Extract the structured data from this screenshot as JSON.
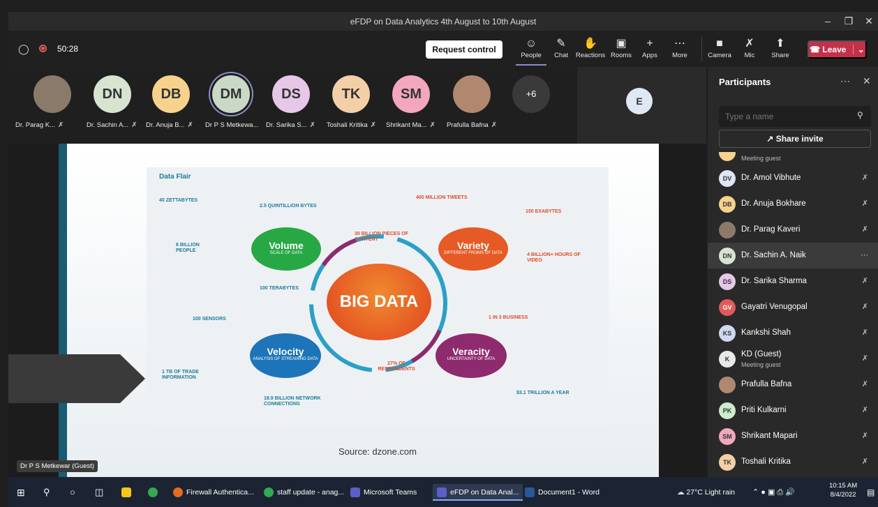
{
  "window": {
    "title": "eFDP on Data Analytics 4th August to 10th August"
  },
  "toolbar": {
    "timer": "50:28",
    "request_control": "Request control",
    "buttons": [
      {
        "label": "People",
        "icon": "people-icon"
      },
      {
        "label": "Chat",
        "icon": "chat-icon"
      },
      {
        "label": "Reactions",
        "icon": "reactions-icon"
      },
      {
        "label": "Rooms",
        "icon": "rooms-icon"
      },
      {
        "label": "Apps",
        "icon": "apps-icon"
      },
      {
        "label": "More",
        "icon": "more-icon"
      },
      {
        "label": "Camera",
        "icon": "camera-off-icon"
      },
      {
        "label": "Mic",
        "icon": "mic-off-icon"
      },
      {
        "label": "Share",
        "icon": "share-icon"
      }
    ],
    "leave": "Leave"
  },
  "strip": {
    "participants": [
      {
        "initials": "",
        "name": "Dr. Parag K...",
        "color": "#8a7a6a"
      },
      {
        "initials": "DN",
        "name": "Dr. Sachin A...",
        "color": "#d7e4d0"
      },
      {
        "initials": "DB",
        "name": "Dr. Anuja B...",
        "color": "#f6d28d"
      },
      {
        "initials": "DM",
        "name": "Dr P S Metkewa...",
        "color": "#c9d9c6"
      },
      {
        "initials": "DS",
        "name": "Dr. Sarika S...",
        "color": "#e6c7e8"
      },
      {
        "initials": "TK",
        "name": "Toshali Kritika",
        "color": "#f3cfa8"
      },
      {
        "initials": "SM",
        "name": "Shrikant Ma...",
        "color": "#f2a7be"
      },
      {
        "initials": "",
        "name": "Prafulla Bafna",
        "color": "#b08870"
      }
    ],
    "overflow": "+6",
    "extra_initial": "E"
  },
  "slide": {
    "source": "Source: dzone.com",
    "presenter": "Dr P S Metkewar (Guest)",
    "infographic": {
      "brand": "Data Flair",
      "center": "BIG DATA",
      "volume": {
        "title": "Volume",
        "sub": "SCALE OF DATA"
      },
      "variety": {
        "title": "Variety",
        "sub": "DIFFERENT FROMS OF DATA"
      },
      "velocity": {
        "title": "Velocity",
        "sub": "ANALYSIS OF STREAMING DATA"
      },
      "veracity": {
        "title": "Veracity",
        "sub": "UNCERTAINTY OF DATA"
      },
      "facts": {
        "zettabytes": "40 ZETTABYTES",
        "quintillion": "2.5 QUINTILLION BYTES",
        "tweets": "400 MILLION TWEETS",
        "exabytes": "150 EXABYTES",
        "billion_people": "6 BILLION PEOPLE",
        "facebook": "30 BILLION PIECES OF CONTENT",
        "terabytes": "100 TERABYTES",
        "video": "4 BILLION+ HOURS OF VIDEO",
        "sensors": "100 SENSORS",
        "business": "1 IN 3 BUSINESS",
        "trade": "1 TB OF TRADE INFORMATION",
        "respondents": "27% OF RESPONDENTS",
        "network": "18.9 BILLION NETWORK CONNECTIONS",
        "trillion": "$3.1 TRILLION A YEAR"
      }
    }
  },
  "pane": {
    "title": "Participants",
    "search_placeholder": "Type a name",
    "share_invite": "Share invite",
    "list": [
      {
        "initials": "",
        "name": "",
        "sub": "Meeting guest",
        "color": "#f6d28d"
      },
      {
        "initials": "DV",
        "name": "Dr. Amol Vibhute",
        "sub": "",
        "color": "#dfe5f5"
      },
      {
        "initials": "DB",
        "name": "Dr. Anuja Bokhare",
        "sub": "",
        "color": "#f6d28d"
      },
      {
        "initials": "",
        "name": "Dr. Parag Kaveri",
        "sub": "",
        "color": "#8a7a6a"
      },
      {
        "initials": "DN",
        "name": "Dr. Sachin A. Naik",
        "sub": "",
        "color": "#d7e4d0"
      },
      {
        "initials": "DS",
        "name": "Dr. Sarika Sharma",
        "sub": "",
        "color": "#e6c7e8"
      },
      {
        "initials": "GV",
        "name": "Gayatri Venugopal",
        "sub": "",
        "color": "#e05a5a"
      },
      {
        "initials": "KS",
        "name": "Kankshi Shah",
        "sub": "",
        "color": "#cfd8f2"
      },
      {
        "initials": "K",
        "name": "KD (Guest)",
        "sub": "Meeting guest",
        "color": "#e8e8e8"
      },
      {
        "initials": "",
        "name": "Prafulla Bafna",
        "sub": "",
        "color": "#b08870"
      },
      {
        "initials": "PK",
        "name": "Priti Kulkarni",
        "sub": "",
        "color": "#cdeccd"
      },
      {
        "initials": "SM",
        "name": "Shrikant Mapari",
        "sub": "",
        "color": "#f2a7be"
      },
      {
        "initials": "TK",
        "name": "Toshali Kritika",
        "sub": "",
        "color": "#f3cfa8"
      }
    ]
  },
  "taskbar": {
    "apps": [
      {
        "label": "Firewall Authentica...",
        "color": "#e66b1f"
      },
      {
        "label": "staff update - anag...",
        "color": "#34a853"
      },
      {
        "label": "Microsoft Teams",
        "color": "#5b5fc7"
      },
      {
        "label": "eFDP on Data Anal...",
        "color": "#5b5fc7"
      },
      {
        "label": "Document1 - Word",
        "color": "#2b579a"
      }
    ],
    "weather": "27°C  Light rain",
    "time": "10:15 AM",
    "date": "8/4/2022"
  }
}
